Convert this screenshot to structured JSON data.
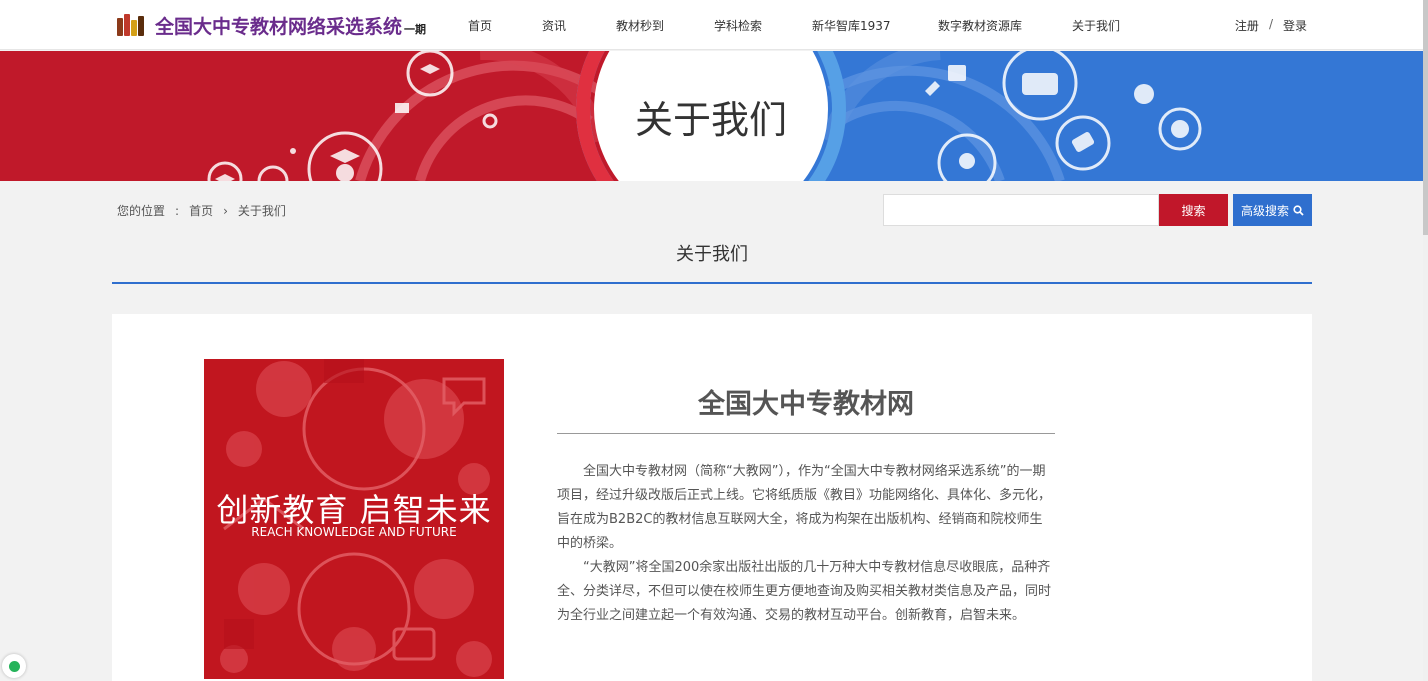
{
  "header": {
    "logo_title": "全国大中专教材网络采选系统",
    "logo_sub": "一期",
    "nav": [
      {
        "label": "首页"
      },
      {
        "label": "资讯"
      },
      {
        "label": "教材秒到"
      },
      {
        "label": "学科检索"
      },
      {
        "label": "新华智库1937"
      },
      {
        "label": "数字教材资源库"
      },
      {
        "label": "关于我们"
      }
    ],
    "register": "注册",
    "separator": "/",
    "login": "登录"
  },
  "banner": {
    "title": "关于我们",
    "left_color": "#c0192a",
    "right_color": "#3477d5"
  },
  "breadcrumb": {
    "label": "您的位置",
    "colon": ":",
    "home": "首页",
    "arrow": "›",
    "current": "关于我们"
  },
  "search": {
    "value": "",
    "placeholder": "",
    "button": "搜索",
    "advanced": "高级搜索"
  },
  "section": {
    "title": "关于我们"
  },
  "about": {
    "promo_cn": "创新教育 启智未来",
    "promo_en": "REACH KNOWLEDGE AND FUTURE",
    "site_name": "全国大中专教材网",
    "paragraphs": [
      "全国大中专教材网（简称“大教网”），作为“全国大中专教材网络采选系统”的一期项目，经过升级改版后正式上线。它将纸质版《教目》功能网络化、具体化、多元化，旨在成为B2B2C的教材信息互联网大全，将成为构架在出版机构、经销商和院校师生中的桥梁。",
      "“大教网”将全国200余家出版社出版的几十万种大中专教材信息尽收眼底，品种齐全、分类详尽，不但可以使在校师生更方便地查询及购买相关教材类信息及产品，同时为全行业之间建立起一个有效沟通、交易的教材互动平台。创新教育，启智未来。"
    ]
  },
  "colors": {
    "red": "#c1172a",
    "blue": "#2f6fce",
    "purple": "#6a2c8c"
  }
}
